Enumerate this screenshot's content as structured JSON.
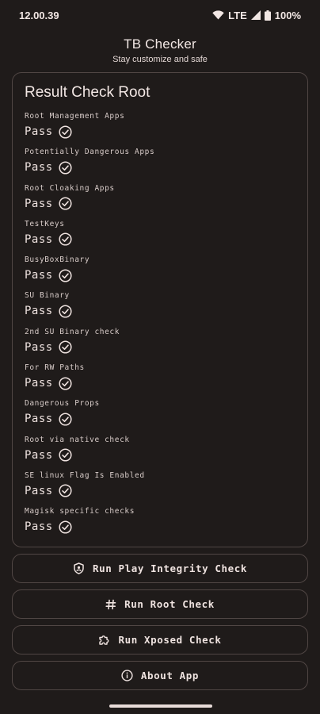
{
  "status_bar": {
    "time": "12.00.39",
    "network": "LTE",
    "battery": "100%",
    "icons": [
      "wifi-icon",
      "signal-icon",
      "battery-icon"
    ]
  },
  "header": {
    "title": "TB Checker",
    "subtitle": "Stay customize and safe"
  },
  "result": {
    "title": "Result Check Root",
    "checks": [
      {
        "label": "Root Management Apps",
        "status": "Pass"
      },
      {
        "label": "Potentially Dangerous Apps",
        "status": "Pass"
      },
      {
        "label": "Root Cloaking Apps",
        "status": "Pass"
      },
      {
        "label": "TestKeys",
        "status": "Pass"
      },
      {
        "label": "BusyBoxBinary",
        "status": "Pass"
      },
      {
        "label": "SU Binary",
        "status": "Pass"
      },
      {
        "label": "2nd SU Binary check",
        "status": "Pass"
      },
      {
        "label": "For RW Paths",
        "status": "Pass"
      },
      {
        "label": "Dangerous Props",
        "status": "Pass"
      },
      {
        "label": "Root via native check",
        "status": "Pass"
      },
      {
        "label": "SE linux Flag Is Enabled",
        "status": "Pass"
      },
      {
        "label": "Magisk specific checks",
        "status": "Pass"
      }
    ]
  },
  "buttons": [
    {
      "label": "Run Play Integrity Check",
      "icon": "shield-icon"
    },
    {
      "label": "Run Root Check",
      "icon": "hash-icon"
    },
    {
      "label": "Run Xposed Check",
      "icon": "puzzle-icon"
    },
    {
      "label": "About App",
      "icon": "info-icon"
    }
  ],
  "colors": {
    "background": "#1f1b1a",
    "outline": "#504644",
    "text": "#efe3e0"
  }
}
